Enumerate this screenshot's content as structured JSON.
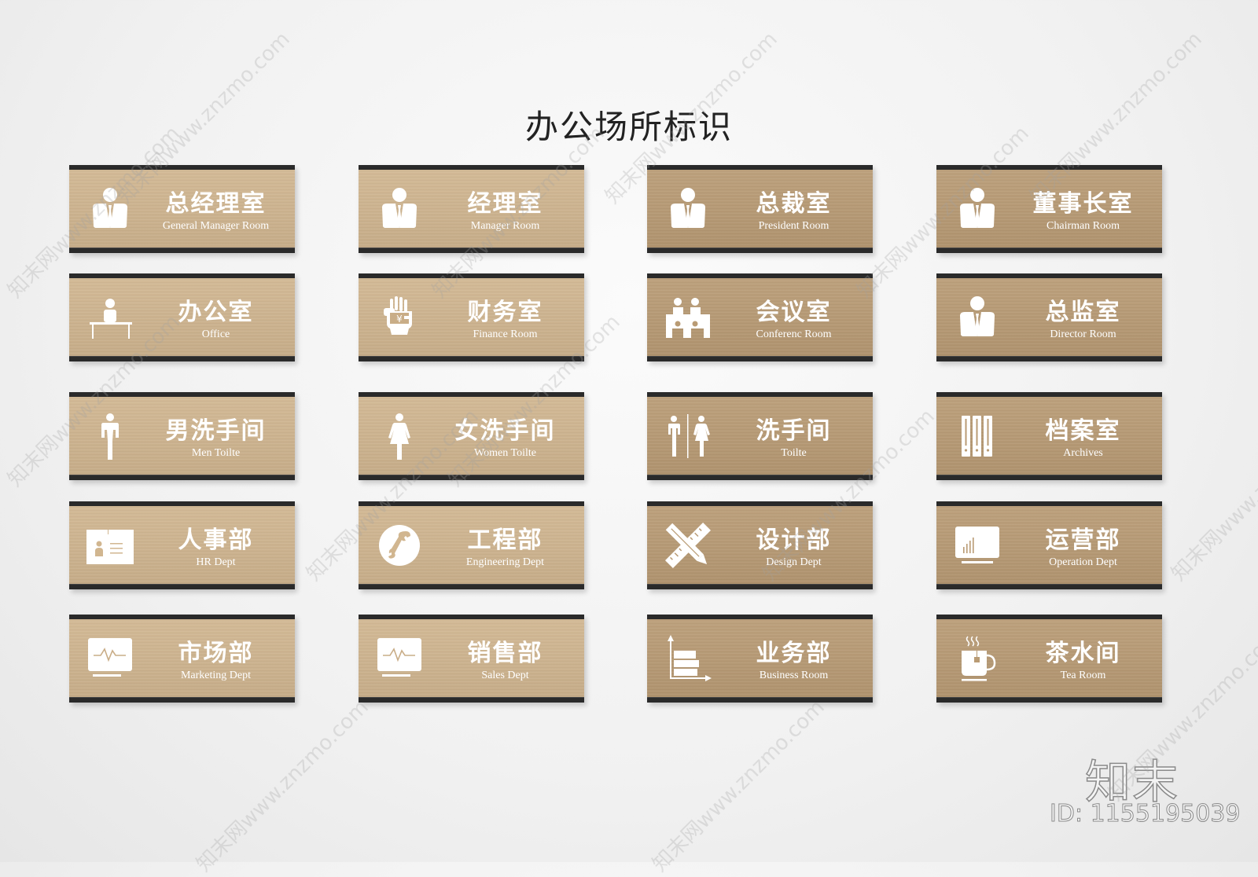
{
  "title": "办公场所标识",
  "signs": [
    {
      "zh": "总经理室",
      "en": "General Manager Room",
      "icon": "manager-person-icon",
      "tone": "light"
    },
    {
      "zh": "经理室",
      "en": "Manager Room",
      "icon": "manager-person-icon",
      "tone": "light"
    },
    {
      "zh": "总裁室",
      "en": "President Room",
      "icon": "manager-person-icon",
      "tone": "dark"
    },
    {
      "zh": "董事长室",
      "en": "Chairman Room",
      "icon": "manager-person-icon",
      "tone": "dark"
    },
    {
      "zh": "办公室",
      "en": "Office",
      "icon": "person-at-desk-icon",
      "tone": "light"
    },
    {
      "zh": "财务室",
      "en": "Finance Room",
      "icon": "hand-yen-icon",
      "tone": "light"
    },
    {
      "zh": "会议室",
      "en": "Conferenc Room",
      "icon": "meeting-people-icon",
      "tone": "dark"
    },
    {
      "zh": "总监室",
      "en": "Director Room",
      "icon": "manager-person-icon",
      "tone": "dark"
    },
    {
      "zh": "男洗手间",
      "en": "Men Toilte",
      "icon": "man-icon",
      "tone": "light"
    },
    {
      "zh": "女洗手间",
      "en": "Women Toilte",
      "icon": "woman-icon",
      "tone": "light"
    },
    {
      "zh": "洗手间",
      "en": "Toilte",
      "icon": "man-woman-icon",
      "tone": "dark"
    },
    {
      "zh": "档案室",
      "en": "Archives",
      "icon": "binders-icon",
      "tone": "dark"
    },
    {
      "zh": "人事部",
      "en": "HR Dept",
      "icon": "id-card-icon",
      "tone": "light"
    },
    {
      "zh": "工程部",
      "en": "Engineering Dept",
      "icon": "wrench-icon",
      "tone": "light"
    },
    {
      "zh": "设计部",
      "en": "Design Dept",
      "icon": "ruler-pencil-icon",
      "tone": "dark"
    },
    {
      "zh": "运营部",
      "en": "Operation Dept",
      "icon": "monitor-chart-icon",
      "tone": "dark"
    },
    {
      "zh": "市场部",
      "en": "Marketing Dept",
      "icon": "monitor-pulse-icon",
      "tone": "light"
    },
    {
      "zh": "销售部",
      "en": "Sales Dept",
      "icon": "monitor-pulse-icon",
      "tone": "light"
    },
    {
      "zh": "业务部",
      "en": "Business Room",
      "icon": "bar-chart-icon",
      "tone": "dark"
    },
    {
      "zh": "茶水间",
      "en": "Tea Room",
      "icon": "tea-cup-icon",
      "tone": "dark"
    }
  ],
  "watermark": {
    "logo": "知末",
    "id": "ID: 1155195039",
    "site_text": "知末网www.znzmo.com"
  }
}
